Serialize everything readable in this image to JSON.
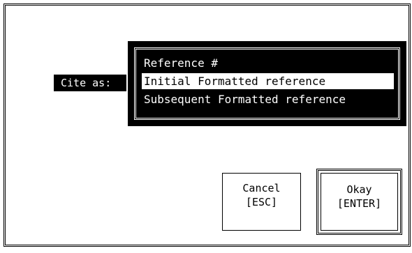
{
  "dialog": {
    "cite_label": "Cite as:",
    "options": [
      "Reference #",
      "Initial Formatted reference",
      "Subsequent Formatted reference"
    ],
    "selected_option": "Initial Formatted reference"
  },
  "buttons": {
    "cancel": {
      "label": "Cancel",
      "shortcut": "[ESC]"
    },
    "okay": {
      "label": "Okay",
      "shortcut": "[ENTER]"
    }
  },
  "colors": {
    "background": "#ffffff",
    "foreground": "#000000",
    "highlight": "#ffffff"
  }
}
